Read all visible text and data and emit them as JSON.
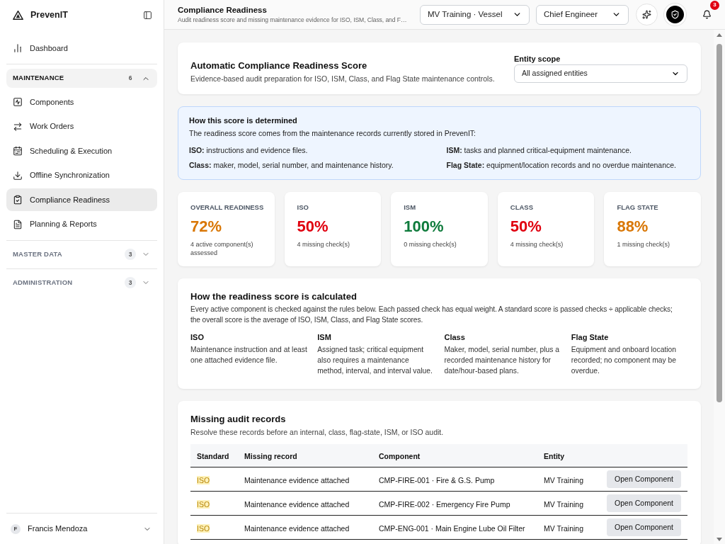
{
  "sidebar": {
    "brand": "PrevenIT",
    "top_items": [
      {
        "label": "Dashboard",
        "selected": false
      }
    ],
    "groups": [
      {
        "label": "MAINTENANCE",
        "count": "6",
        "expanded": true,
        "items": [
          {
            "label": "Components",
            "selected": false
          },
          {
            "label": "Work Orders",
            "selected": false
          },
          {
            "label": "Scheduling & Execution",
            "selected": false
          },
          {
            "label": "Offline Synchronization",
            "selected": false
          },
          {
            "label": "Compliance Readiness",
            "selected": true
          },
          {
            "label": "Planning & Reports",
            "selected": false
          }
        ]
      },
      {
        "label": "MASTER DATA",
        "count": "3",
        "expanded": false
      },
      {
        "label": "ADMINISTRATION",
        "count": "3",
        "expanded": false
      }
    ],
    "user": {
      "initial": "F",
      "name": "Francis Mendoza"
    }
  },
  "header": {
    "title": "Compliance Readiness",
    "subtitle": "Audit readiness score and missing maintenance evidence for ISO, ISM, Class, and F…",
    "vessel_select": {
      "value": "MV Training · Vessel"
    },
    "role_select": {
      "value": "Chief Engineer"
    },
    "notifications": {
      "count": "3"
    }
  },
  "score_card": {
    "title": "Automatic Compliance Readiness Score",
    "subtitle": "Evidence-based audit preparation for ISO, ISM, Class, and Flag State maintenance controls.",
    "entity_scope": {
      "label": "Entity scope",
      "value": "All assigned entities"
    }
  },
  "score_info": {
    "title": "How this score is determined",
    "intro": "The readiness score comes from the maintenance records currently stored in PrevenIT:",
    "rules": [
      "**ISO:** instructions and evidence files.",
      "**ISM:** tasks and planned critical-equipment maintenance.",
      "**Class:** maker, model, serial number, and maintenance history.",
      "**Flag State:** equipment/location records and no overdue maintenance."
    ]
  },
  "stats": [
    {
      "label": "OVERALL READINESS",
      "value": "72%",
      "note": "4 active component(s) assessed",
      "color": "#d97706"
    },
    {
      "label": "ISO",
      "value": "50%",
      "note": "4 missing check(s)",
      "color": "#e0000f"
    },
    {
      "label": "ISM",
      "value": "100%",
      "note": "0 missing check(s)",
      "color": "#0f7b3c"
    },
    {
      "label": "CLASS",
      "value": "50%",
      "note": "4 missing check(s)",
      "color": "#e0000f"
    },
    {
      "label": "FLAG STATE",
      "value": "88%",
      "note": "1 missing check(s)",
      "color": "#d97706"
    }
  ],
  "calculation": {
    "title": "How the readiness score is calculated",
    "text": "Every active component is checked against the rules below. Each passed check has equal weight. A standard score is passed checks ÷ applicable checks; the overall score is the average of ISO, ISM, Class, and Flag State scores.",
    "standards": [
      {
        "name": "ISO",
        "text": "Maintenance instruction and at least one attached evidence file."
      },
      {
        "name": "ISM",
        "text": "Assigned task; critical equipment also requires a maintenance method, interval, and interval value."
      },
      {
        "name": "Class",
        "text": "Maker, model, serial number, plus a recorded maintenance history for date/hour-based plans."
      },
      {
        "name": "Flag State",
        "text": "Equipment and onboard location recorded; no component may be overdue."
      }
    ]
  },
  "missing_records": {
    "title": "Missing audit records",
    "subtitle": "Resolve these records before an internal, class, flag-state, ISM, or ISO audit.",
    "columns": [
      "Standard",
      "Missing record",
      "Component",
      "Entity"
    ],
    "rows": [
      {
        "standard": "ISO",
        "missing_record": "Maintenance evidence attached",
        "component": "CMP-FIRE-001 · Fire & G.S. Pump",
        "entity": "MV Training",
        "action": "Open Component"
      },
      {
        "standard": "ISO",
        "missing_record": "Maintenance evidence attached",
        "component": "CMP-FIRE-002 · Emergency Fire Pump",
        "entity": "MV Training",
        "action": "Open Component"
      },
      {
        "standard": "ISO",
        "missing_record": "Maintenance evidence attached",
        "component": "CMP-ENG-001 · Main Engine Lube Oil Filter",
        "entity": "MV Training",
        "action": "Open Component"
      }
    ]
  }
}
